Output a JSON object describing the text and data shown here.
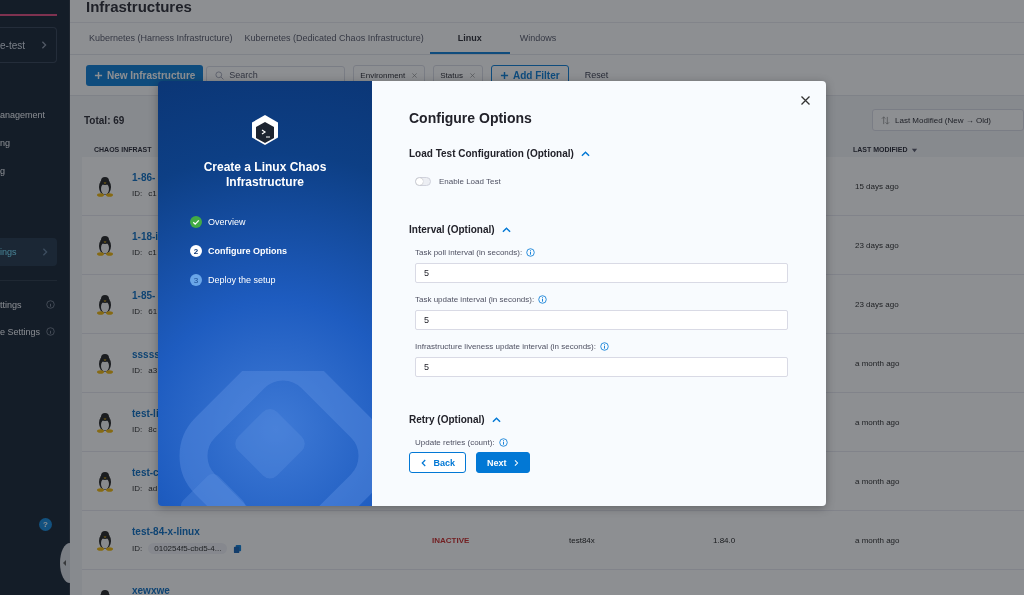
{
  "sidebar": {
    "project": "e-test",
    "items": [
      {
        "label": "anagement",
        "selected": false
      },
      {
        "label": "ng",
        "selected": false
      },
      {
        "label": "g",
        "selected": false
      },
      {
        "label": "ings",
        "selected": true
      }
    ],
    "settings": [
      {
        "label": "ttings"
      },
      {
        "label": "e Settings"
      }
    ],
    "help_badge": "?"
  },
  "page": {
    "title": "Infrastructures",
    "tabs": [
      {
        "label": "Kubernetes (Harness Infrastructure)",
        "selected": false
      },
      {
        "label": "Kubernetes (Dedicated Chaos Infrastructure)",
        "selected": false
      },
      {
        "label": "Linux",
        "selected": true
      },
      {
        "label": "Windows",
        "selected": false
      }
    ],
    "toolbar": {
      "new_button": "New Infrastructure",
      "search_placeholder": "Search",
      "filters": [
        "Environment",
        "Status"
      ],
      "add_filter": "Add Filter",
      "reset": "Reset"
    },
    "total": "Total: 69",
    "sort": "Last Modified (New → Old)",
    "columns": [
      "CHAOS INFRAST",
      "LAST MODIFIED"
    ],
    "rows": [
      {
        "name": "1-86-",
        "id_label": "ID:",
        "id": "c1",
        "last_modified": "15 days ago"
      },
      {
        "name": "1-18-i",
        "id_label": "ID:",
        "id": "c1",
        "last_modified": "23 days ago"
      },
      {
        "name": "1-85-",
        "id_label": "ID:",
        "id": "61",
        "last_modified": "23 days ago"
      },
      {
        "name": "sssss",
        "id_label": "ID:",
        "id": "a3",
        "last_modified": "a month ago"
      },
      {
        "name": "test-li",
        "id_label": "ID:",
        "id": "8c",
        "last_modified": "a month ago"
      },
      {
        "name": "test-c",
        "id_label": "ID:",
        "id": "ad",
        "last_modified": "a month ago"
      },
      {
        "name": "test-84-x-linux",
        "id_label": "ID:",
        "id": "010254f5-cbd5-4...",
        "status": "INACTIVE",
        "column_4": "test84x",
        "version": "1.84.0",
        "last_modified": "a month ago"
      },
      {
        "name": "xewxwe"
      }
    ]
  },
  "modal": {
    "title": "Create a Linux Chaos Infrastructure",
    "steps": [
      {
        "label": "Overview",
        "completed": true,
        "selected": false
      },
      {
        "label": "Configure Options",
        "completed": false,
        "selected": true,
        "number": "2"
      },
      {
        "label": "Deploy the setup",
        "completed": false,
        "selected": false,
        "number": "3"
      }
    ],
    "heading": "Configure Options",
    "sections": [
      {
        "title": "Load Test Configuration (Optional)",
        "expanded": true,
        "fields": [
          {
            "kind": "toggle",
            "label": "Enable Load Test",
            "on": false
          }
        ]
      },
      {
        "title": "Interval (Optional)",
        "expanded": true,
        "fields": [
          {
            "kind": "number",
            "label": "Task poll interval (in seconds):",
            "value": "5"
          },
          {
            "kind": "number",
            "label": "Task update interval (in seconds):",
            "value": "5"
          },
          {
            "kind": "number",
            "label": "Infrastructure liveness update interval (in seconds):",
            "value": "5"
          }
        ]
      },
      {
        "title": "Retry (Optional)",
        "expanded": true,
        "fields": [
          {
            "kind": "label",
            "label": "Update retries (count):"
          }
        ]
      }
    ],
    "back": "Back",
    "next": "Next"
  }
}
